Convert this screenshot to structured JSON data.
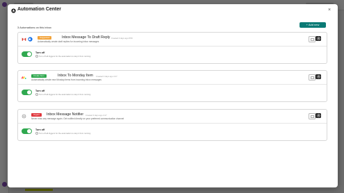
{
  "modal": {
    "title": "Automation Center",
    "count_text": "3 Automations on this inbox",
    "add_new_label": "+ Add new",
    "close_label": "×",
    "colors": {
      "accent": "#0b7a75",
      "toggle_on": "#2fa84f"
    }
  },
  "automations": [
    {
      "tag": "Suggested",
      "tag_color": "#f2a33a",
      "name": "Inbox Message To Draft Reply",
      "created": "Created 3 days ago 8:59",
      "description": "Automatically create draft replies for incoming inbox messages",
      "toggle_label": "Turn off",
      "toggle_hint": "Turn off all triggers for the automation to stop it from running",
      "enabled": true,
      "icons": [
        "gmail-icon",
        "outlook-icon"
      ]
    },
    {
      "tag": "Create Item",
      "tag_color": "#2fa84f",
      "name": "Inbox To Monday Item",
      "created": "Created 3 days ago 4:17",
      "description": "Automatically create new Monday items from incoming inbox messages",
      "toggle_label": "Turn off",
      "toggle_hint": "Turn off all triggers for the automation to stop it from running",
      "enabled": true,
      "icons": [
        "monday-icon"
      ]
    },
    {
      "tag": "Urgent",
      "tag_color": "#e0383e",
      "name": "Inbox Message Notifier",
      "created": "Created 3 days ago 4:17",
      "description": "Never miss any message again. Get notified directly on your preferred communication channel",
      "toggle_label": "Turn off",
      "toggle_hint": "Turn off all triggers for the automation to stop it from running",
      "enabled": true,
      "icons": [
        "notifier-icon"
      ]
    }
  ]
}
